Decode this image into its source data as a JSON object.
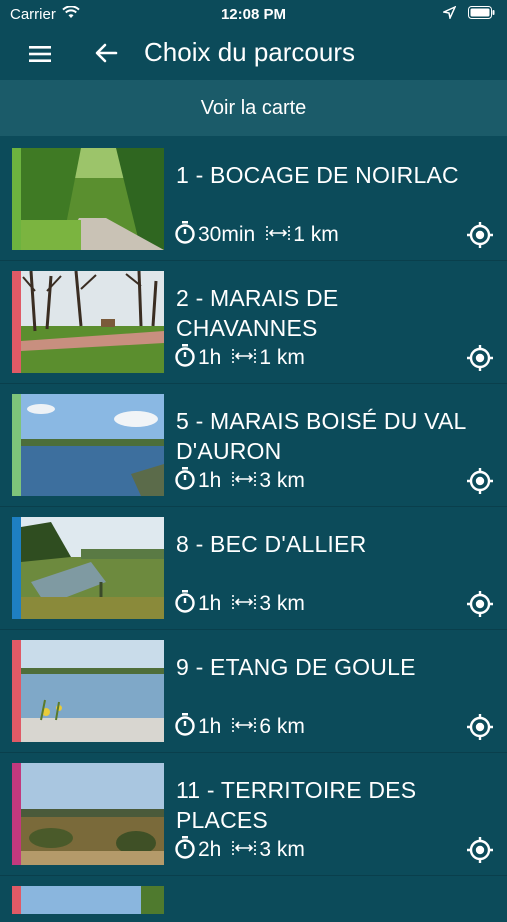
{
  "status": {
    "carrier": "Carrier",
    "time": "12:08 PM"
  },
  "header": {
    "title": "Choix du parcours",
    "menu_icon": "hamburger-icon",
    "back_icon": "arrow-left-icon"
  },
  "map_button": {
    "label": "Voir la carte"
  },
  "routes": [
    {
      "title": "1 - BOCAGE DE NOIRLAC",
      "duration": "30min",
      "distance": "1 km",
      "color": "#6db33f"
    },
    {
      "title": "2 - MARAIS DE CHAVANNES",
      "duration": "1h",
      "distance": "1 km",
      "color": "#e05a66"
    },
    {
      "title": "5 - MARAIS BOISÉ DU VAL D'AURON",
      "duration": "1h",
      "distance": "3 km",
      "color": "#7ec47a"
    },
    {
      "title": "8 - BEC D'ALLIER",
      "duration": "1h",
      "distance": "3 km",
      "color": "#1e7fc2"
    },
    {
      "title": "9 - ETANG DE GOULE",
      "duration": "1h",
      "distance": "6 km",
      "color": "#e05a66"
    },
    {
      "title": "11 - TERRITOIRE DES PLACES",
      "duration": "2h",
      "distance": "3 km",
      "color": "#c2397e"
    }
  ],
  "icons": {
    "duration": "stopwatch-icon",
    "distance": "distance-arrows-icon",
    "locate": "locate-icon"
  }
}
